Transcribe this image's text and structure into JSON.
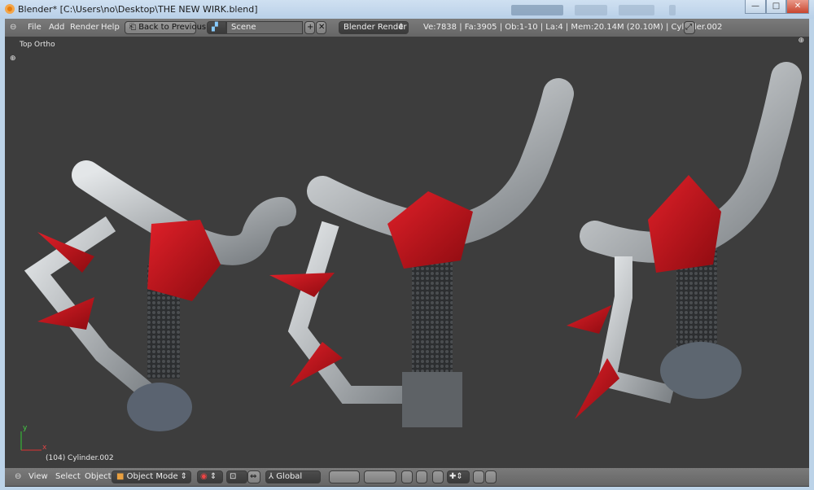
{
  "window": {
    "title": "Blender* [C:\\Users\\no\\Desktop\\THE NEW WIRK.blend]",
    "minimize": "—",
    "maximize": "□",
    "close": "✕"
  },
  "top_header": {
    "menu": [
      "File",
      "Add",
      "Render",
      "Help"
    ],
    "back_button": "Back to Previous",
    "scene": "Scene",
    "scene_add": "+",
    "scene_remove": "✕",
    "render_engine": "Blender Render",
    "stats": "Ve:7838 | Fa:3905 | Ob:1-10 | La:4 | Mem:20.14M (20.10M) | Cylinder.002"
  },
  "viewport": {
    "view_label": "Top Ortho",
    "object_info": "(104) Cylinder.002",
    "axis_y": "y",
    "axis_x": "x",
    "colors": {
      "background": "#3d3d3d",
      "red": "#c0141b",
      "metal": "#b8bcc0"
    }
  },
  "bottom_header": {
    "menu": [
      "View",
      "Select",
      "Object"
    ],
    "mode": "Object Mode",
    "orientation": "Global"
  }
}
